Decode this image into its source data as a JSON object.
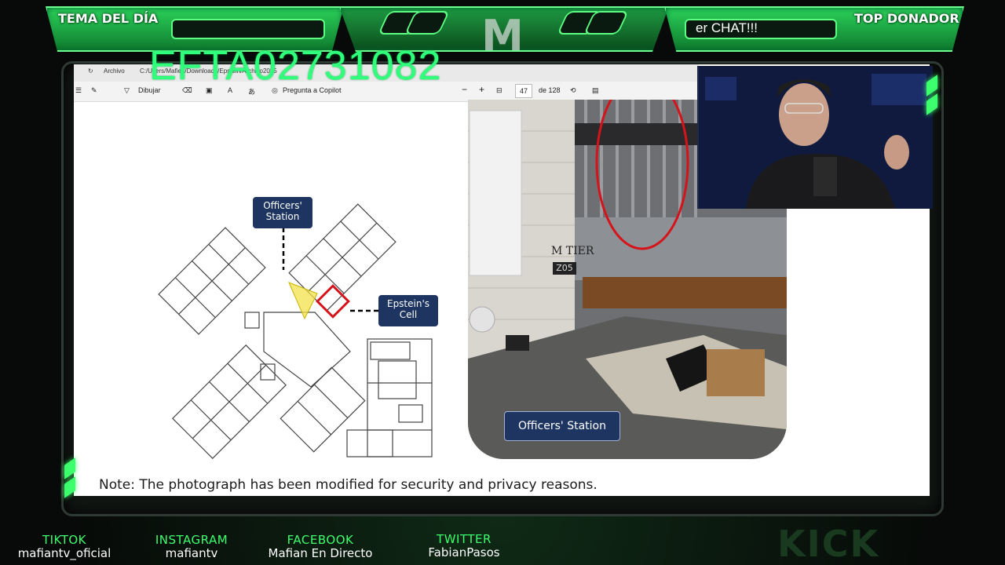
{
  "hud": {
    "left_label": "TEMA DEL DÍA",
    "right_label": "TOP DONADOR",
    "ticker_text": "er CHAT!!!",
    "logo_letter": "M"
  },
  "watermark": "EFTA02731082",
  "viewer": {
    "address": "C:/Users/Mafien/Downloads/Epstein/Archivo2025",
    "address_prefix": "Archivo",
    "draw_label": "Dibujar",
    "copilot_label": "Pregunta a Copilot",
    "page_current": "47",
    "page_total": "de 128",
    "zoom_out": "−",
    "zoom_in": "+"
  },
  "slide": {
    "officers_station_label": "Officers'\nStation",
    "epstein_cell_label": "Epstein's\nCell",
    "photo_caption": "Officers' Station",
    "photo_sign_tier": "M TIER",
    "photo_sign_number": "Z05",
    "note": "Note:  The photograph has been modified for security and privacy reasons."
  },
  "social": [
    {
      "network": "TIKTOK",
      "handle": "mafiantv_oficial"
    },
    {
      "network": "INSTAGRAM",
      "handle": "mafiantv"
    },
    {
      "network": "FACEBOOK",
      "handle": "Mafian En Directo"
    },
    {
      "network": "TWITTER",
      "handle": "FabianPasos"
    }
  ],
  "kick_logo": "KICK",
  "colors": {
    "neon_green": "#3dff6e",
    "slide_navy": "#1d3560",
    "highlight_red": "#d4141a",
    "highlight_yellow": "#f3e24a"
  }
}
